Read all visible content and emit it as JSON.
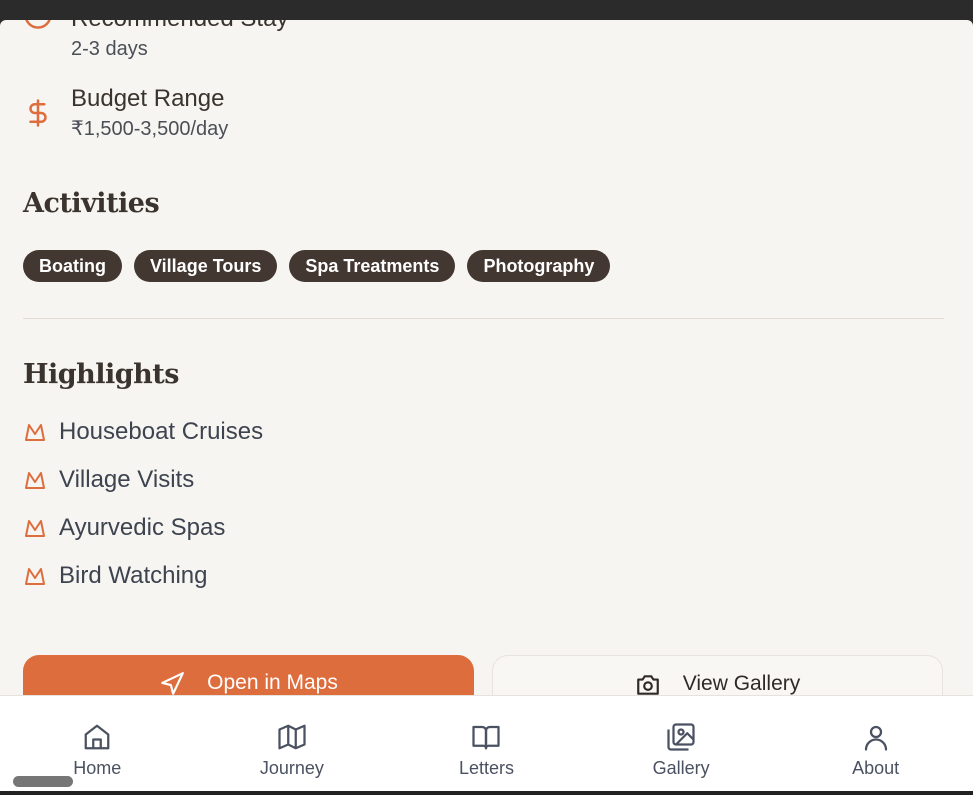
{
  "info": {
    "stay": {
      "label": "Recommended Stay",
      "value": "2-3 days",
      "icon": "clock-icon"
    },
    "budget": {
      "label": "Budget Range",
      "value": "₹1,500-3,500/day",
      "icon": "dollar-icon"
    }
  },
  "activities": {
    "title": "Activities",
    "chips": [
      "Boating",
      "Village Tours",
      "Spa Treatments",
      "Photography"
    ]
  },
  "highlights": {
    "title": "Highlights",
    "items": [
      "Houseboat Cruises",
      "Village Visits",
      "Ayurvedic Spas",
      "Bird Watching"
    ]
  },
  "actions": {
    "maps_label": "Open in Maps",
    "gallery_label": "View Gallery"
  },
  "nav": {
    "items": [
      {
        "label": "Home",
        "icon": "home-icon"
      },
      {
        "label": "Journey",
        "icon": "map-icon"
      },
      {
        "label": "Letters",
        "icon": "book-icon"
      },
      {
        "label": "Gallery",
        "icon": "gallery-icon"
      },
      {
        "label": "About",
        "icon": "user-icon"
      }
    ]
  },
  "colors": {
    "accent": "#de6d3d",
    "chip": "#433731",
    "background": "#f7f5f1"
  }
}
